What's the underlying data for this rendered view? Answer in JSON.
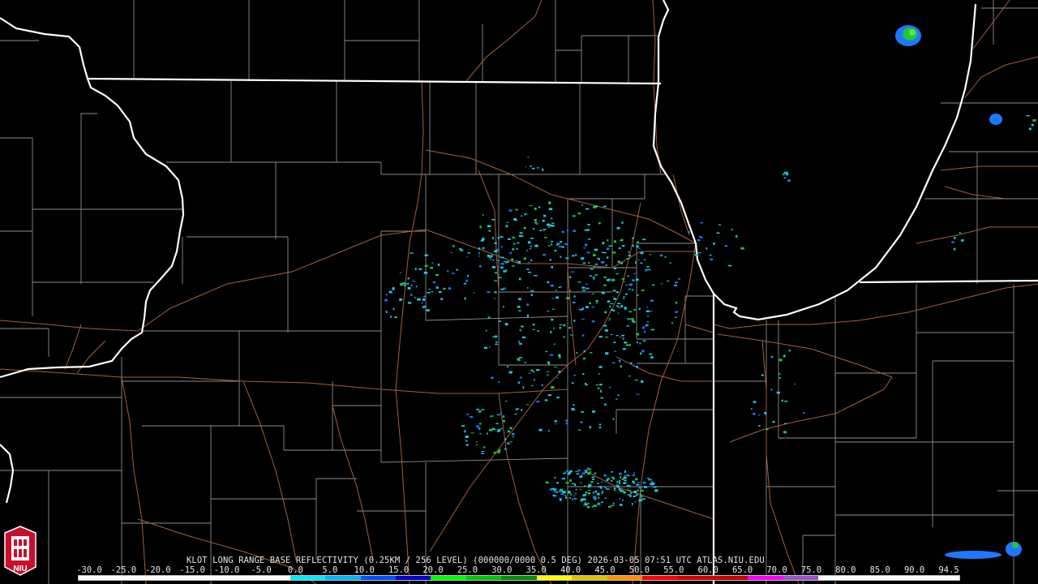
{
  "product": {
    "caption": "KLOT LONG RANGE BASE REFLECTIVITY (0.25KM / 256 LEVEL) (000000/0000 0.5 DEG) 2026-03-05 07:51 UTC  ATLAS.NIU.EDU"
  },
  "scale": {
    "labels": [
      "-30.0",
      "-25.0",
      "-20.0",
      "-15.0",
      "-10.0",
      "-5.0",
      "0.0",
      "5.0",
      "10.0",
      "15.0",
      "20.0",
      "25.0",
      "30.0",
      "35.0",
      "40.0",
      "45.0",
      "50.0",
      "55.0",
      "60.0",
      "65.0",
      "70.0",
      "75.0",
      "80.0",
      "85.0",
      "90.0",
      "94.5"
    ],
    "colors": [
      "#ffffff",
      "#ffffff",
      "#ffffff",
      "#ffffff",
      "#ffffff",
      "#ffffff",
      "#00e8ff",
      "#00b4ff",
      "#0050ff",
      "#0000c8",
      "#00ff00",
      "#00c800",
      "#009000",
      "#ffff00",
      "#e6c000",
      "#ff9000",
      "#ff0000",
      "#d00000",
      "#c00000",
      "#ff00ff",
      "#9955c9",
      "#ffffff",
      "#ffffff",
      "#ffffff",
      "#ffffff"
    ]
  },
  "logo": {
    "text": "NIU"
  },
  "colors": {
    "state_border": "#ffffff",
    "county_border": "#8c8c8c",
    "highway": "#a0603c",
    "background": "#000000",
    "echo_light": "#1ec8e6",
    "echo_medium": "#1e78ff",
    "echo_strong": "#22c63a"
  }
}
